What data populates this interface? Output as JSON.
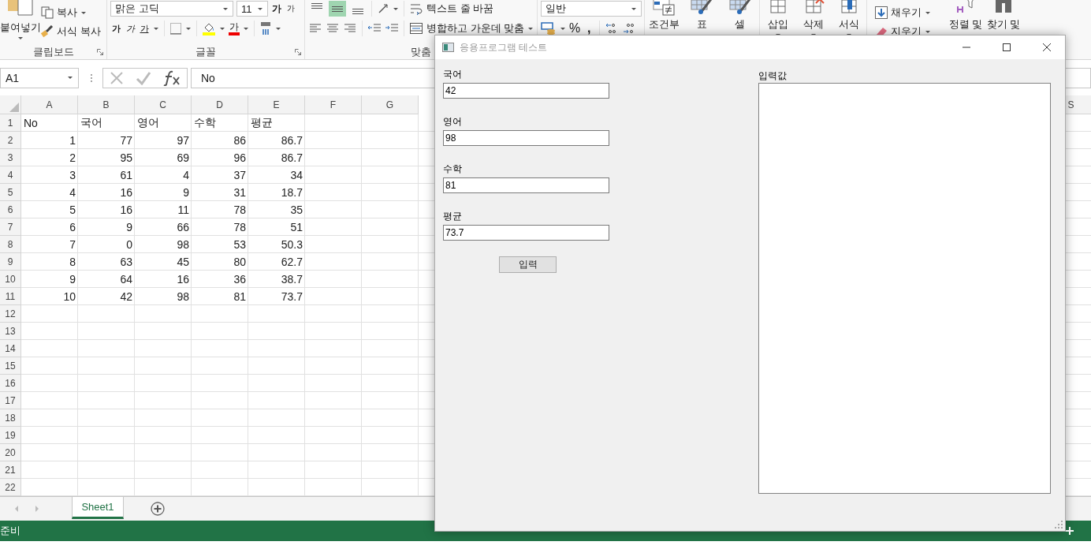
{
  "ribbon": {
    "clipboard": {
      "paste": "붙여넣기",
      "copy": "복사",
      "format_painter": "서식 복사",
      "label": "클립보드"
    },
    "font": {
      "font_name": "맑은 고딕",
      "font_size": "11",
      "grow": "가",
      "shrink": "가",
      "bold": "가",
      "italic": "가",
      "underline": "가",
      "font_color": "가",
      "label": "글꼴"
    },
    "alignment": {
      "vertical": [
        {
          "selected": false
        },
        {
          "selected": true
        },
        {
          "selected": false
        }
      ],
      "wrap_text": "텍스트 줄 바꿈",
      "merge": "병합하고 가운데 맞춤",
      "label": "맞춤"
    },
    "number": {
      "format": "일반",
      "percent": "%",
      "comma": ","
    },
    "styles": [
      "조건부",
      "표",
      "셀"
    ],
    "cells": [
      "삽입",
      "삭제",
      "서식"
    ],
    "editing": {
      "fill": "채우기",
      "clear": "지우기",
      "sort": "정렬 및",
      "find": "찾기 및"
    }
  },
  "name_box": "A1",
  "formula": "No",
  "columns": [
    "A",
    "B",
    "C",
    "D",
    "E",
    "F",
    "G",
    "S"
  ],
  "rows": [
    {
      "num": "1",
      "kind": "header",
      "cells": [
        "No",
        "국어",
        "영어",
        "수학",
        "평균"
      ]
    },
    {
      "num": "2",
      "kind": "data",
      "cells": [
        "1",
        "77",
        "97",
        "86",
        "86.7"
      ]
    },
    {
      "num": "3",
      "kind": "data",
      "cells": [
        "2",
        "95",
        "69",
        "96",
        "86.7"
      ]
    },
    {
      "num": "4",
      "kind": "data",
      "cells": [
        "3",
        "61",
        "4",
        "37",
        "34"
      ]
    },
    {
      "num": "5",
      "kind": "data",
      "cells": [
        "4",
        "16",
        "9",
        "31",
        "18.7"
      ]
    },
    {
      "num": "6",
      "kind": "data",
      "cells": [
        "5",
        "16",
        "11",
        "78",
        "35"
      ]
    },
    {
      "num": "7",
      "kind": "data",
      "cells": [
        "6",
        "9",
        "66",
        "78",
        "51"
      ]
    },
    {
      "num": "8",
      "kind": "data",
      "cells": [
        "7",
        "0",
        "98",
        "53",
        "50.3"
      ]
    },
    {
      "num": "9",
      "kind": "data",
      "cells": [
        "8",
        "63",
        "45",
        "80",
        "62.7"
      ]
    },
    {
      "num": "10",
      "kind": "data",
      "cells": [
        "9",
        "64",
        "16",
        "36",
        "38.7"
      ]
    },
    {
      "num": "11",
      "kind": "data",
      "cells": [
        "10",
        "42",
        "98",
        "81",
        "73.7"
      ]
    },
    {
      "num": "12"
    },
    {
      "num": "13"
    },
    {
      "num": "14"
    },
    {
      "num": "15"
    },
    {
      "num": "16"
    },
    {
      "num": "17"
    },
    {
      "num": "18"
    },
    {
      "num": "19"
    },
    {
      "num": "20"
    },
    {
      "num": "21"
    },
    {
      "num": "22"
    }
  ],
  "sheet_tabs": [
    {
      "label": "Sheet1",
      "selected": true
    }
  ],
  "status": "준비",
  "dialog": {
    "title": "응용프로그램 테스트",
    "fields": [
      {
        "label": "국어",
        "value": "42"
      },
      {
        "label": "영어",
        "value": "98"
      },
      {
        "label": "수학",
        "value": "81"
      },
      {
        "label": "평균",
        "value": "73.7"
      }
    ],
    "button": "입력",
    "output_label": "입력값"
  }
}
